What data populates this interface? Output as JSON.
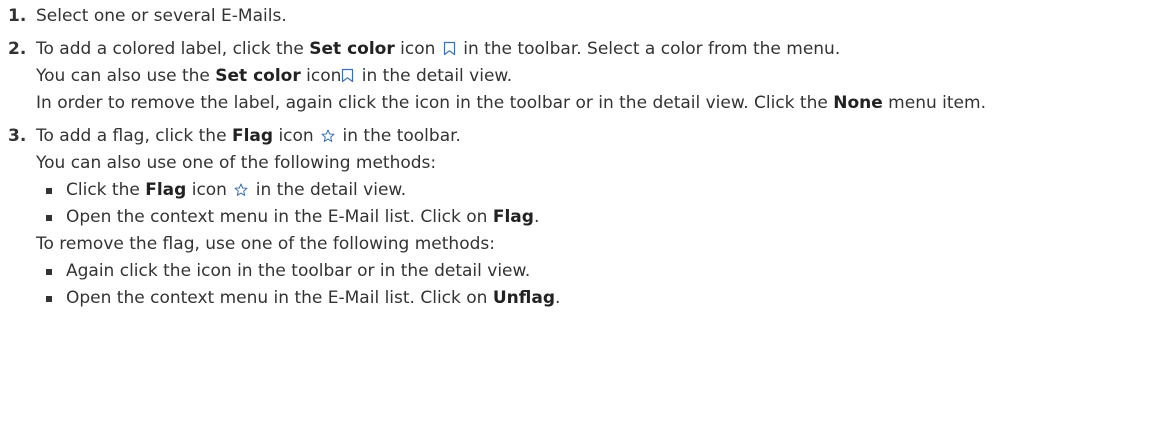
{
  "steps": [
    {
      "number": "1.",
      "text": "Select one or several E-Mails."
    },
    {
      "number": "2.",
      "line1_pre": "To add a colored label, click the ",
      "line1_bold": "Set color",
      "line1_mid": " icon ",
      "line1_post": " in the toolbar. Select a color from the menu.",
      "line2_pre": "You can also use the ",
      "line2_bold": "Set color",
      "line2_mid": " icon",
      "line2_post": " in the detail view.",
      "line3_pre": "In order to remove the label, again click the icon in the toolbar or in the detail view. Click the ",
      "line3_bold": "None",
      "line3_post": " menu item."
    },
    {
      "number": "3.",
      "line1_pre": "To add a flag, click the ",
      "line1_bold": "Flag",
      "line1_mid": " icon ",
      "line1_post": " in the toolbar.",
      "line2": "You can also use one of the following methods:",
      "bullets_add": [
        {
          "pre": "Click the ",
          "bold": "Flag",
          "mid": " icon ",
          "post": " in the detail view."
        },
        {
          "pre": "Open the context menu in the E-Mail list. Click on ",
          "bold": "Flag",
          "post": "."
        }
      ],
      "line_remove": "To remove the flag, use one of the following methods:",
      "bullets_remove": [
        {
          "text": "Again click the icon in the toolbar or in the detail view."
        },
        {
          "pre": "Open the context menu in the E-Mail list. Click on ",
          "bold": "Unflag",
          "post": "."
        }
      ]
    }
  ],
  "icons": {
    "set_color": "bookmark-icon",
    "flag": "star-icon",
    "icon_color": "#3b6fb6"
  }
}
